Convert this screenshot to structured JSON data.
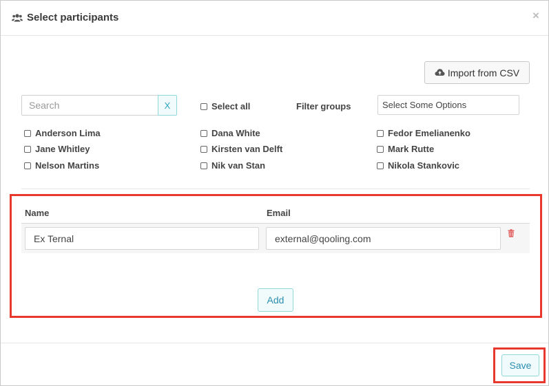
{
  "header": {
    "title": "Select participants",
    "icon": "users-icon",
    "close_label": "×"
  },
  "toolbar": {
    "import_label": "Import from CSV",
    "import_icon": "cloud-upload-icon"
  },
  "search": {
    "placeholder": "Search",
    "value": "",
    "clear_label": "X"
  },
  "select_all": {
    "label": "Select all",
    "checked": false
  },
  "filter": {
    "label": "Filter groups",
    "placeholder": "Select Some Options"
  },
  "participants": [
    {
      "name": "Anderson Lima",
      "checked": false
    },
    {
      "name": "Jane Whitley",
      "checked": false
    },
    {
      "name": "Nelson Martins",
      "checked": false
    },
    {
      "name": "Dana White",
      "checked": false
    },
    {
      "name": "Kirsten van Delft",
      "checked": false
    },
    {
      "name": "Nik van Stan",
      "checked": false
    },
    {
      "name": "Fedor Emelianenko",
      "checked": false
    },
    {
      "name": "Mark Rutte",
      "checked": false
    },
    {
      "name": "Nikola Stankovic",
      "checked": false
    }
  ],
  "external": {
    "columns": {
      "name": "Name",
      "email": "Email"
    },
    "rows": [
      {
        "name": "Ex Ternal",
        "email": "external@qooling.com"
      }
    ],
    "add_label": "Add",
    "delete_icon": "trash-icon"
  },
  "footer": {
    "save_label": "Save"
  },
  "colors": {
    "accent": "#2a8fb0",
    "accent_border": "#8fd8da",
    "highlight": "#e8372c",
    "danger": "#e05a5a"
  }
}
